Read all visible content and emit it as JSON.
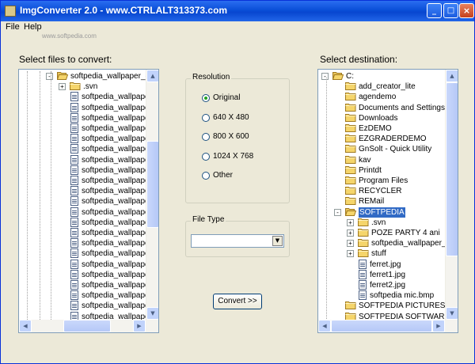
{
  "window": {
    "title": "ImgConverter 2.0 - www.CTRLALT313373.com"
  },
  "titlebar": {
    "minimize_label": "_",
    "maximize_label": "□",
    "close_label": "×"
  },
  "menu": [
    {
      "label": "File"
    },
    {
      "label": "Help"
    }
  ],
  "watermark": "www.softpedia.com",
  "left_panel": {
    "label": "Select files to convert:",
    "items": [
      {
        "label": "softpedia_wallpaper_chri",
        "type": "folder",
        "depth": 0,
        "expander": "-"
      },
      {
        "label": ".svn",
        "type": "folder",
        "depth": 1,
        "expander": "+"
      },
      {
        "label": "softpedia_wallpaper_",
        "type": "file",
        "depth": 1
      },
      {
        "label": "softpedia_wallpaper_",
        "type": "file",
        "depth": 1
      },
      {
        "label": "softpedia_wallpaper_",
        "type": "file",
        "depth": 1
      },
      {
        "label": "softpedia_wallpaper_",
        "type": "file",
        "depth": 1
      },
      {
        "label": "softpedia_wallpaper_",
        "type": "file",
        "depth": 1
      },
      {
        "label": "softpedia_wallpaper_",
        "type": "file",
        "depth": 1
      },
      {
        "label": "softpedia_wallpaper_",
        "type": "file",
        "depth": 1
      },
      {
        "label": "softpedia_wallpaper_",
        "type": "file",
        "depth": 1
      },
      {
        "label": "softpedia_wallpaper_",
        "type": "file",
        "depth": 1
      },
      {
        "label": "softpedia_wallpaper_",
        "type": "file",
        "depth": 1
      },
      {
        "label": "softpedia_wallpaper_",
        "type": "file",
        "depth": 1
      },
      {
        "label": "softpedia_wallpaper_",
        "type": "file",
        "depth": 1
      },
      {
        "label": "softpedia_wallpaper_",
        "type": "file",
        "depth": 1
      },
      {
        "label": "softpedia_wallpaper_",
        "type": "file",
        "depth": 1
      },
      {
        "label": "softpedia_wallpaper_",
        "type": "file",
        "depth": 1
      },
      {
        "label": "softpedia_wallpaper_",
        "type": "file",
        "depth": 1
      },
      {
        "label": "softpedia_wallpaper_",
        "type": "file",
        "depth": 1
      },
      {
        "label": "softpedia_wallpaper_",
        "type": "file",
        "depth": 1
      },
      {
        "label": "softpedia_wallpaper_",
        "type": "file",
        "depth": 1
      },
      {
        "label": "softpedia_wallpaper_",
        "type": "file",
        "depth": 1
      },
      {
        "label": "softpedia_wallpaper_",
        "type": "file",
        "depth": 1
      },
      {
        "label": "softpedia_wallpaper_",
        "type": "file",
        "depth": 1
      },
      {
        "label": "softpedia_wallpaper_",
        "type": "file",
        "depth": 1
      }
    ]
  },
  "resolution": {
    "legend": "Resolution",
    "options": [
      {
        "label": "Original",
        "selected": true
      },
      {
        "label": "640 X 480",
        "selected": false
      },
      {
        "label": "800 X 600",
        "selected": false
      },
      {
        "label": "1024 X 768",
        "selected": false
      },
      {
        "label": "Other",
        "selected": false
      }
    ]
  },
  "file_type": {
    "legend": "File Type",
    "value": "",
    "arrow": "▼"
  },
  "convert_button": {
    "label": "Convert >>"
  },
  "right_panel": {
    "label": "Select destination:",
    "items": [
      {
        "label": "C:",
        "type": "folder",
        "depth": 0,
        "expander": "-"
      },
      {
        "label": "add_creator_lite",
        "type": "folder",
        "depth": 1
      },
      {
        "label": "agendemo",
        "type": "folder",
        "depth": 1
      },
      {
        "label": "Documents and Settings",
        "type": "folder",
        "depth": 1
      },
      {
        "label": "Downloads",
        "type": "folder",
        "depth": 1
      },
      {
        "label": "EzDEMO",
        "type": "folder",
        "depth": 1
      },
      {
        "label": "EZGRADERDEMO",
        "type": "folder",
        "depth": 1
      },
      {
        "label": "GnSolt - Quick Utility",
        "type": "folder",
        "depth": 1
      },
      {
        "label": "kav",
        "type": "folder",
        "depth": 1
      },
      {
        "label": "Printdt",
        "type": "folder",
        "depth": 1
      },
      {
        "label": "Program Files",
        "type": "folder",
        "depth": 1
      },
      {
        "label": "RECYCLER",
        "type": "folder",
        "depth": 1
      },
      {
        "label": "REMail",
        "type": "folder",
        "depth": 1
      },
      {
        "label": "SOFTPEDIA",
        "type": "folder",
        "depth": 1,
        "expander": "-",
        "selected": true
      },
      {
        "label": ".svn",
        "type": "folder",
        "depth": 2,
        "expander": "+"
      },
      {
        "label": "POZE PARTY 4 ani",
        "type": "folder",
        "depth": 2,
        "expander": "+"
      },
      {
        "label": "softpedia_wallpaper_chri",
        "type": "folder",
        "depth": 2,
        "expander": "+"
      },
      {
        "label": "stuff",
        "type": "folder",
        "depth": 2,
        "expander": "+"
      },
      {
        "label": "ferret.jpg",
        "type": "file",
        "depth": 2
      },
      {
        "label": "ferret1.jpg",
        "type": "file",
        "depth": 2
      },
      {
        "label": "ferret2.jpg",
        "type": "file",
        "depth": 2
      },
      {
        "label": "softpedia mic.bmp",
        "type": "file",
        "depth": 2
      },
      {
        "label": "SOFTPEDIA PICTURES",
        "type": "folder",
        "depth": 1
      },
      {
        "label": "SOFTPEDIA SOFTWARE",
        "type": "folder",
        "depth": 1
      }
    ]
  },
  "colors": {
    "titlebar": "#0a4fd8",
    "selection": "#316ac5",
    "folder": "#f5d56b",
    "window_bg": "#ece9d8"
  }
}
